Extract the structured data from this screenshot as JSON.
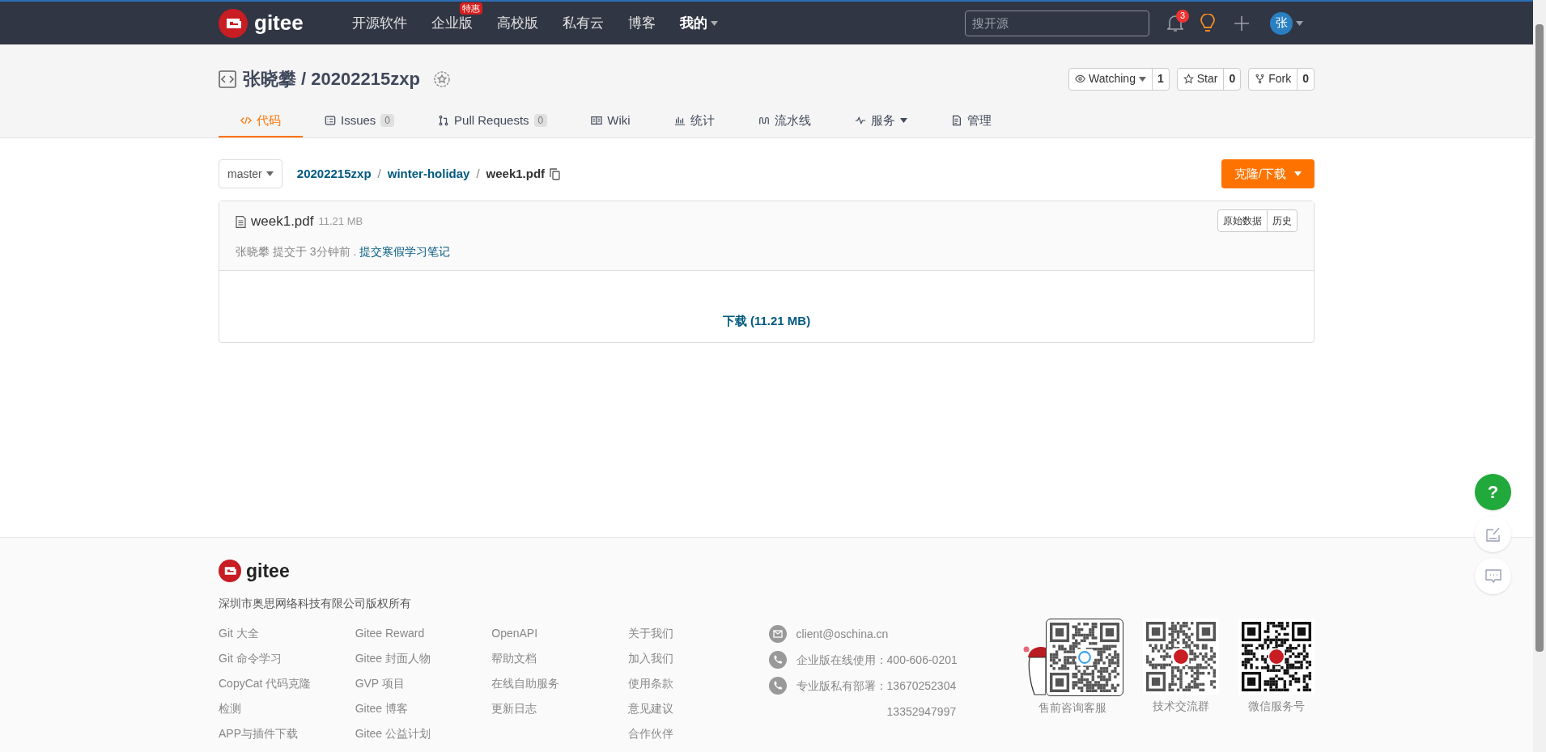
{
  "header": {
    "logo": "gitee",
    "nav": [
      {
        "label": "开源软件",
        "dropdown": false
      },
      {
        "label": "企业版",
        "badge": "特惠",
        "dropdown": false
      },
      {
        "label": "高校版",
        "dropdown": false
      },
      {
        "label": "私有云",
        "dropdown": false
      },
      {
        "label": "博客",
        "dropdown": false
      },
      {
        "label": "我的",
        "dropdown": true
      }
    ],
    "search": {
      "placeholder": "搜开源"
    },
    "notifications": "3",
    "avatar": "张"
  },
  "repo": {
    "owner": "张晓攀",
    "separator": "/",
    "name": "20202215zxp",
    "actions": [
      {
        "kind": "eye",
        "label": "Watching",
        "count": "1",
        "dropdown": true
      },
      {
        "kind": "star",
        "label": "Star",
        "count": "0",
        "dropdown": false
      },
      {
        "kind": "fork",
        "label": "Fork",
        "count": "0",
        "dropdown": false
      }
    ]
  },
  "tabs": [
    {
      "kind": "code",
      "label": "代码",
      "selected": true,
      "dropdown": false
    },
    {
      "kind": "issues",
      "label": "Issues",
      "count": "0",
      "selected": false,
      "dropdown": false
    },
    {
      "kind": "pr",
      "label": "Pull Requests",
      "count": "0",
      "selected": false,
      "dropdown": false
    },
    {
      "kind": "wiki",
      "label": "Wiki",
      "selected": false,
      "dropdown": false
    },
    {
      "kind": "chart",
      "label": "统计",
      "selected": false,
      "dropdown": false
    },
    {
      "kind": "pipeline",
      "label": "流水线",
      "selected": false,
      "dropdown": false
    },
    {
      "kind": "pulse",
      "label": "服务",
      "selected": false,
      "dropdown": true
    },
    {
      "kind": "doc",
      "label": "管理",
      "selected": false,
      "dropdown": false
    }
  ],
  "toolbar": {
    "branch": "master",
    "breadcrumb": [
      "20202215zxp",
      "winter-holiday",
      "week1.pdf"
    ],
    "separator": "/",
    "clone_button": "克隆/下载"
  },
  "file": {
    "name": "week1.pdf",
    "size": "11.21 MB",
    "buttons": [
      "原始数据",
      "历史"
    ],
    "commit": {
      "text": "张晓攀 提交于 3分钟前 .",
      "message": "提交寒假学习笔记"
    },
    "download": "下载 (11.21 MB)"
  },
  "footer": {
    "logo": "gitee",
    "copyright": "深圳市奥思网络科技有限公司版权所有",
    "link_columns": [
      [
        "Git 大全",
        "Git 命令学习",
        "CopyCat 代码克隆",
        "检测",
        "APP与插件下载"
      ],
      [
        "Gitee Reward",
        "Gitee 封面人物",
        "GVP 项目",
        "Gitee 博客",
        "Gitee 公益计划"
      ],
      [
        "OpenAPI",
        "帮助文档",
        "在线自助服务",
        "更新日志"
      ],
      [
        "关于我们",
        "加入我们",
        "使用条款",
        "意见建议",
        "合作伙伴"
      ]
    ],
    "contacts": [
      {
        "kind": "email",
        "label": "client@oschina.cn"
      },
      {
        "kind": "phone",
        "label": "企业版在线使用：",
        "numbers": [
          "400-606-0201"
        ]
      },
      {
        "kind": "phone",
        "label": "专业版私有部署：",
        "numbers": [
          "13670252304",
          "13352947997"
        ]
      }
    ],
    "qr_codes": [
      {
        "caption": "售前咨询客服",
        "kind": "chat"
      },
      {
        "caption": "技术交流群",
        "kind": "logo"
      },
      {
        "caption": "微信服务号",
        "kind": "logo"
      }
    ]
  },
  "help": {
    "label": "?"
  }
}
